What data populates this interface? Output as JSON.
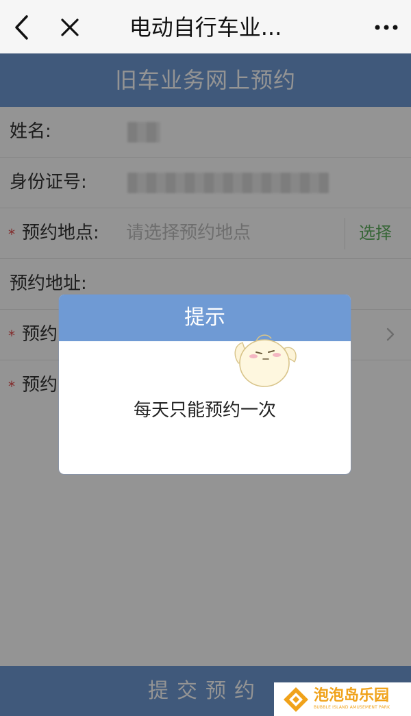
{
  "topbar": {
    "title": "电动自行车业...",
    "back_icon": "chevron-left-icon",
    "close_icon": "close-icon",
    "more_icon": "more-dots-icon"
  },
  "header": {
    "title": "旧车业务网上预约"
  },
  "form": {
    "name_label": "姓名:",
    "id_label": "身份证号:",
    "location_label": "预约地点:",
    "location_placeholder": "请选择预约地点",
    "location_select": "选择",
    "address_label": "预约地址:",
    "row5_label": "预约",
    "row6_label": "预约",
    "required_mark": "*"
  },
  "modal": {
    "title": "提示",
    "message": "每天只能预约一次"
  },
  "submit": {
    "label": "提交预约"
  },
  "watermark": {
    "name": "泡泡岛乐园",
    "sub": "BUBBLE ISLAND AMUSEMENT PARK"
  },
  "colors": {
    "header_blue": "#6f9ad4",
    "select_green": "#5fb05f",
    "required_red": "#e04848",
    "watermark_orange": "#f0a21a"
  }
}
